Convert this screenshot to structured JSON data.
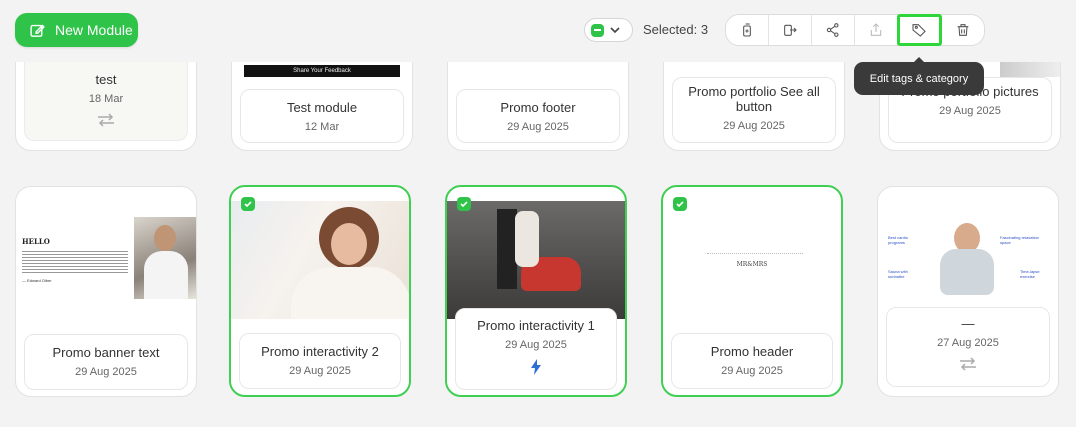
{
  "toolbar": {
    "new_module_label": "New Module",
    "selected_label": "Selected: 3",
    "tooltip": "Edit tags & category",
    "tools": [
      "duplicate-icon",
      "move-to-icon",
      "share-icon",
      "export-icon",
      "tag-icon",
      "trash-icon"
    ]
  },
  "row1": [
    {
      "name": "test",
      "date": "18 Mar",
      "thumb_caption": ""
    },
    {
      "name": "Test module",
      "date": "12 Mar",
      "thumb_caption": "Share Your Feedback"
    },
    {
      "name": "Promo footer",
      "date": "29 Aug 2025"
    },
    {
      "name": "Promo portfolio See all button",
      "date": "29 Aug 2025"
    },
    {
      "name": "Promo portfolio pictures",
      "date": "29 Aug 2025"
    }
  ],
  "row2": [
    {
      "name": "Promo banner text",
      "date": "29 Aug 2025",
      "thumb_title": "HELLO",
      "thumb_sig": "— Edward Olber"
    },
    {
      "name": "Promo interactivity 2",
      "date": "29 Aug 2025"
    },
    {
      "name": "Promo interactivity 1",
      "date": "29 Aug 2025"
    },
    {
      "name": "Promo header",
      "date": "29 Aug 2025",
      "thumb_logo": "MR&MRS"
    },
    {
      "name": "—",
      "date": "27 Aug 2025",
      "thumb_labels": [
        "Best cardio programs",
        "Fascinating relaxation space",
        "Sauna with sunbathe",
        "Time-lapse exercise"
      ]
    }
  ],
  "colors": {
    "accent": "#2fc449",
    "tooltip_bg": "#3a3a3a",
    "highlight": "#2ed63a"
  }
}
